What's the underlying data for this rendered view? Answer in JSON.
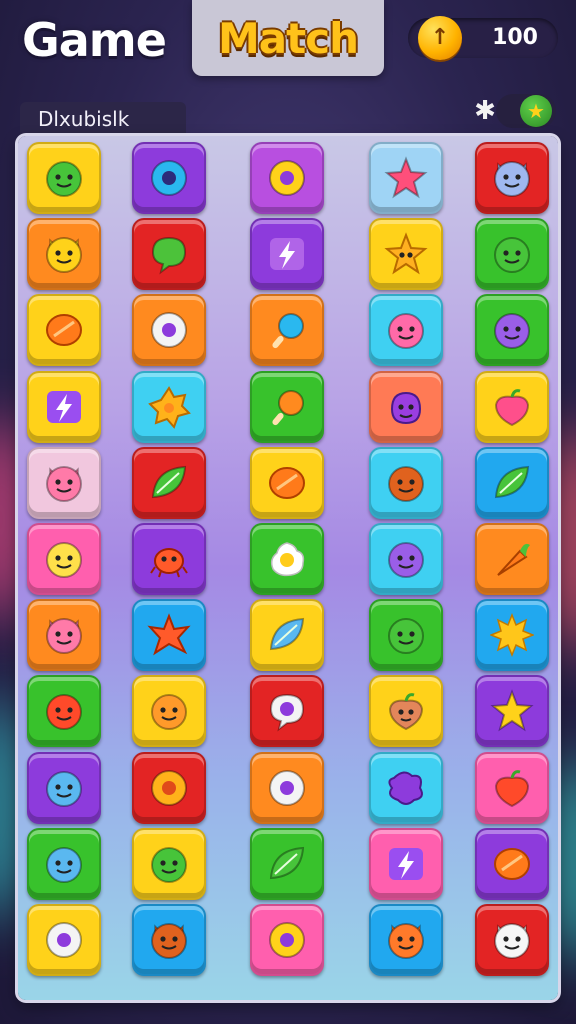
{
  "header": {
    "title_left": "Game",
    "title_right": "Match",
    "coins": "100"
  },
  "panel": {
    "label": "Dlxubislk"
  },
  "colors": {
    "yellow": "#ffd21a",
    "purple": "#8d3bdc",
    "violet": "#b84fe0",
    "orange": "#ff8a1f",
    "red": "#e32424",
    "green": "#38c22c",
    "blue": "#21a8ef",
    "cyan": "#3fd0f2",
    "pink": "#ff5fae",
    "lightblue": "#9fd4f5",
    "lightpink": "#f1c7de",
    "coral": "#ff7a55"
  },
  "board": {
    "rows": [
      [
        {
          "color": "yellow",
          "icon": "green-blob-face-icon"
        },
        {
          "color": "purple",
          "icon": "blue-donut-icon"
        },
        {
          "color": "violet",
          "icon": "yellow-ring-icon"
        },
        {
          "color": "lightblue",
          "icon": "pink-star-icon"
        },
        {
          "color": "red",
          "icon": "blue-cat-face-icon"
        }
      ],
      [
        {
          "color": "orange",
          "icon": "yellow-bear-face-icon"
        },
        {
          "color": "red",
          "icon": "green-chat-bubble-icon"
        },
        {
          "color": "purple",
          "icon": "lightning-bolt-icon"
        },
        {
          "color": "yellow",
          "icon": "orange-star-face-icon"
        },
        {
          "color": "green",
          "icon": "green-smiley-icon"
        }
      ],
      [
        {
          "color": "yellow",
          "icon": "orange-candy-icon"
        },
        {
          "color": "orange",
          "icon": "purple-ring-icon"
        },
        {
          "color": "orange",
          "icon": "blue-lollipop-icon"
        },
        {
          "color": "cyan",
          "icon": "pink-smiley-icon"
        },
        {
          "color": "green",
          "icon": "purple-blob-icon"
        }
      ],
      [
        {
          "color": "yellow",
          "icon": "purple-bolt-icon"
        },
        {
          "color": "cyan",
          "icon": "orange-flower-icon"
        },
        {
          "color": "green",
          "icon": "orange-drumstick-icon"
        },
        {
          "color": "coral",
          "icon": "purple-monster-icon"
        },
        {
          "color": "yellow",
          "icon": "pink-strawberry-icon"
        }
      ],
      [
        {
          "color": "lightpink",
          "icon": "pink-cat-face-icon"
        },
        {
          "color": "red",
          "icon": "green-leaf-icon"
        },
        {
          "color": "yellow",
          "icon": "orange-candy-icon"
        },
        {
          "color": "cyan",
          "icon": "brown-face-icon"
        },
        {
          "color": "blue",
          "icon": "green-leaf-icon"
        }
      ],
      [
        {
          "color": "pink",
          "icon": "yellow-cloud-face-icon"
        },
        {
          "color": "purple",
          "icon": "red-bug-icon"
        },
        {
          "color": "green",
          "icon": "fried-egg-icon"
        },
        {
          "color": "cyan",
          "icon": "purple-cloud-face-icon"
        },
        {
          "color": "orange",
          "icon": "carrot-icon"
        }
      ],
      [
        {
          "color": "orange",
          "icon": "pink-cat-face-icon"
        },
        {
          "color": "blue",
          "icon": "red-star-burst-icon"
        },
        {
          "color": "yellow",
          "icon": "blue-feather-icon"
        },
        {
          "color": "green",
          "icon": "green-blob-icon"
        },
        {
          "color": "blue",
          "icon": "yellow-sun-icon"
        }
      ],
      [
        {
          "color": "green",
          "icon": "red-blob-icon"
        },
        {
          "color": "yellow",
          "icon": "orange-smiley-icon"
        },
        {
          "color": "red",
          "icon": "purple-chat-bubble-icon"
        },
        {
          "color": "yellow",
          "icon": "brown-apple-face-icon"
        },
        {
          "color": "purple",
          "icon": "yellow-star-icon"
        }
      ],
      [
        {
          "color": "purple",
          "icon": "blue-drop-face-icon"
        },
        {
          "color": "red",
          "icon": "orange-donut-face-icon"
        },
        {
          "color": "orange",
          "icon": "purple-ring-icon"
        },
        {
          "color": "cyan",
          "icon": "purple-splat-icon"
        },
        {
          "color": "pink",
          "icon": "red-tomato-icon"
        }
      ],
      [
        {
          "color": "green",
          "icon": "blue-cloud-face-icon"
        },
        {
          "color": "yellow",
          "icon": "green-blob-face-icon"
        },
        {
          "color": "green",
          "icon": "green-leaf-icon"
        },
        {
          "color": "pink",
          "icon": "purple-bolt-icon"
        },
        {
          "color": "purple",
          "icon": "orange-candy-icon"
        }
      ],
      [
        {
          "color": "yellow",
          "icon": "purple-ring-icon"
        },
        {
          "color": "blue",
          "icon": "brown-bear-face-icon"
        },
        {
          "color": "pink",
          "icon": "yellow-ring-icon"
        },
        {
          "color": "blue",
          "icon": "orange-cat-face-icon"
        },
        {
          "color": "red",
          "icon": "white-cat-face-icon"
        }
      ]
    ]
  }
}
